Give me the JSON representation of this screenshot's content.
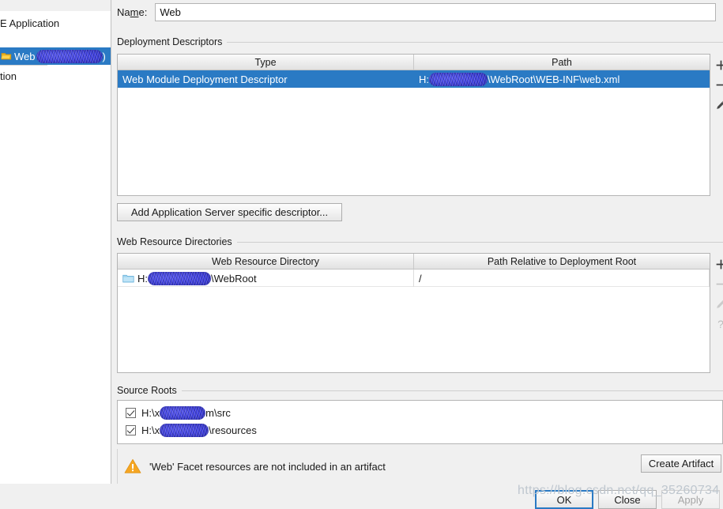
{
  "sidebar": {
    "items": [
      {
        "label": "E Application",
        "icon": "",
        "selected": false,
        "redacted": false
      },
      {
        "label": "Web",
        "icon": "module-icon",
        "selected": true,
        "redacted": true
      },
      {
        "label": "tion",
        "icon": "",
        "selected": false,
        "redacted": false
      }
    ]
  },
  "name_field": {
    "label_pre": "Na",
    "label_mnemonic": "m",
    "label_post": "e:",
    "value": "Web",
    "placeholder": ""
  },
  "deployment_descriptors": {
    "group_label": "Deployment Descriptors",
    "columns": [
      "Type",
      "Path"
    ],
    "rows": [
      {
        "type": "Web Module Deployment Descriptor",
        "path_prefix": "H:",
        "path_redacted": true,
        "path_suffix": "\\WebRoot\\WEB-INF\\web.xml",
        "selected": true
      }
    ],
    "toolbar": [
      {
        "icon": "plus-icon",
        "glyph": "+",
        "enabled": true
      },
      {
        "icon": "minus-icon",
        "glyph": "−",
        "enabled": true
      },
      {
        "icon": "pencil-icon",
        "glyph": "✎",
        "enabled": true
      }
    ],
    "add_server_descriptor_button": "Add Application Server specific descriptor..."
  },
  "web_resource_directories": {
    "group_label": "Web Resource Directories",
    "columns": [
      "Web Resource Directory",
      "Path Relative to Deployment Root"
    ],
    "rows": [
      {
        "directory_prefix": "H:",
        "directory_redacted": true,
        "directory_suffix": "\\WebRoot",
        "relative_path": "/",
        "icon": "folder-icon"
      }
    ],
    "toolbar": [
      {
        "icon": "plus-icon",
        "glyph": "+",
        "enabled": true
      },
      {
        "icon": "minus-icon",
        "glyph": "−",
        "enabled": false
      },
      {
        "icon": "pencil-icon",
        "glyph": "✎",
        "enabled": false
      },
      {
        "icon": "help-icon",
        "glyph": "?",
        "enabled": false
      }
    ]
  },
  "source_roots": {
    "group_label": "Source Roots",
    "rows": [
      {
        "checked": true,
        "prefix": "H:\\x",
        "redacted": true,
        "suffix": "m\\src"
      },
      {
        "checked": true,
        "prefix": "H:\\x",
        "redacted": true,
        "suffix": "\\resources"
      }
    ]
  },
  "warning": {
    "icon": "warning-triangle-icon",
    "message": "'Web' Facet resources are not included in an artifact",
    "action_button": "Create Artifact"
  },
  "footer": {
    "ok_button": "OK",
    "close_button": "Close",
    "apply_button": "Apply"
  },
  "watermark": {
    "text": "https://blog.csdn.net/qq_35260734"
  },
  "colors": {
    "selection_blue": "#2a7ac4",
    "redaction_blue": "#3c3ddc",
    "warning_amber": "#f5a623",
    "window_bg": "#f0f0f0",
    "field_bg": "#ffffff"
  }
}
